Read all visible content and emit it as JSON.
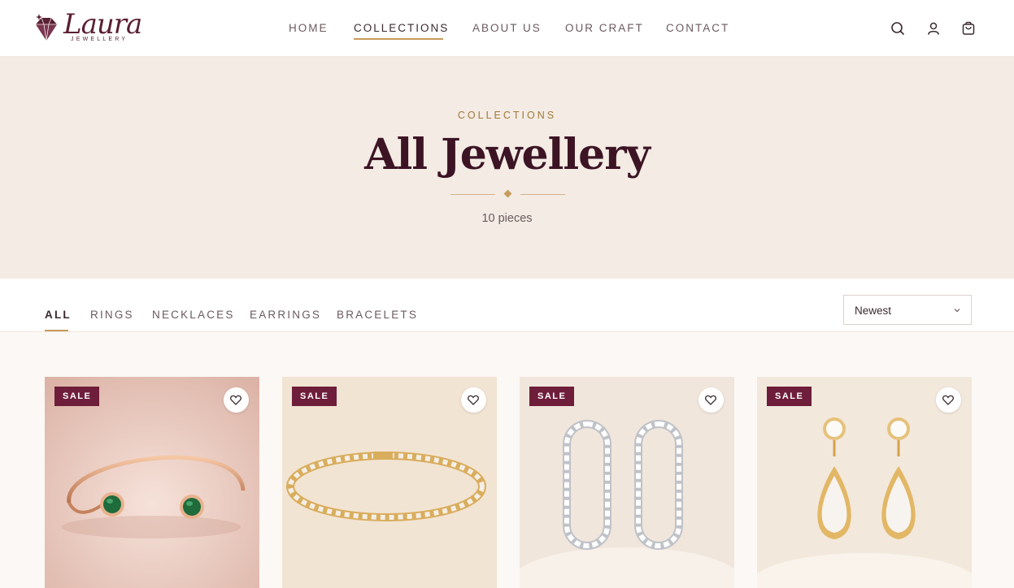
{
  "brand": {
    "name": "Laura",
    "tagline": "JEWELLERY"
  },
  "nav": {
    "items": [
      {
        "label": "HOME"
      },
      {
        "label": "COLLECTIONS",
        "active": true
      },
      {
        "label": "ABOUT US"
      },
      {
        "label": "OUR CRAFT"
      },
      {
        "label": "CONTACT"
      }
    ]
  },
  "header_icons": [
    "search-icon",
    "account-icon",
    "cart-icon"
  ],
  "hero": {
    "eyebrow": "COLLECTIONS",
    "title": "All Jewellery",
    "count": "10 pieces"
  },
  "filters": {
    "tabs": [
      {
        "label": "ALL",
        "active": true
      },
      {
        "label": "RINGS"
      },
      {
        "label": "NECKLACES"
      },
      {
        "label": "EARRINGS"
      },
      {
        "label": "BRACELETS"
      }
    ],
    "sort": {
      "selected": "Newest"
    }
  },
  "products": [
    {
      "badge": "SALE",
      "image": "rose-gold-emerald-cuff"
    },
    {
      "badge": "SALE",
      "image": "gold-diamond-tennis-bracelet"
    },
    {
      "badge": "SALE",
      "image": "white-gold-diamond-hoops"
    },
    {
      "badge": "SALE",
      "image": "gold-pear-diamond-drop-earrings"
    }
  ],
  "colors": {
    "brand_plum": "#5a1f34",
    "badge": "#6e1d3a",
    "gold_accent": "#c79b5c",
    "hero_bg": "#f3ebe4"
  }
}
